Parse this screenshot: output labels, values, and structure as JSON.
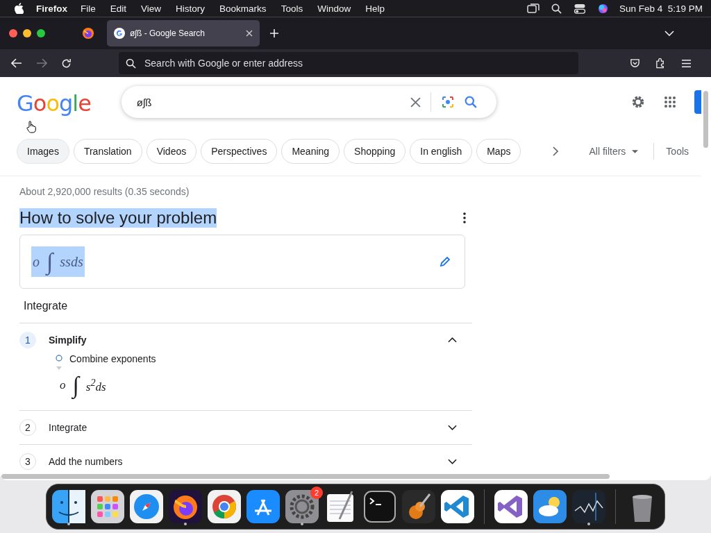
{
  "menubar": {
    "app": "Firefox",
    "menus": [
      "File",
      "Edit",
      "View",
      "History",
      "Bookmarks",
      "Tools",
      "Window",
      "Help"
    ],
    "clock": "Sun Feb 4  5:19 PM"
  },
  "tabs": [
    {
      "title": "øʃß - Google Search",
      "selected": true
    }
  ],
  "address_bar": {
    "placeholder": "Search with Google or enter address"
  },
  "nav": {
    "forward_disabled": true
  },
  "google": {
    "logo": "Google",
    "query": "øʃß",
    "chips": [
      {
        "label": "Images",
        "selected": true
      },
      {
        "label": "Translation",
        "selected": false
      },
      {
        "label": "Videos",
        "selected": false
      },
      {
        "label": "Perspectives",
        "selected": false
      },
      {
        "label": "Meaning",
        "selected": false
      },
      {
        "label": "Shopping",
        "selected": false
      },
      {
        "label": "In english",
        "selected": false
      },
      {
        "label": "Maps",
        "selected": false
      }
    ],
    "all_filters": "All filters",
    "tools": "Tools",
    "stats": "About 2,920,000 results (0.35 seconds)",
    "solver": {
      "heading": "How to solve your problem",
      "highlighted": true,
      "formula": {
        "coefficient": "o",
        "operator": "∫",
        "integrand": "ssds",
        "highlighted": true
      },
      "action": "Integrate",
      "steps": [
        {
          "number": "1",
          "title": "Simplify",
          "expanded": true,
          "substeps": [
            {
              "label": "Combine exponents",
              "formula": {
                "coefficient": "o",
                "operator": "∫",
                "integrand": "s$^{2}$ds"
              }
            }
          ]
        },
        {
          "number": "2",
          "title": "Integrate",
          "expanded": false
        },
        {
          "number": "3",
          "title": "Add the numbers",
          "expanded": false
        }
      ]
    }
  },
  "dock": [
    {
      "kind": "finder",
      "running": true
    },
    {
      "kind": "launchpad",
      "running": false
    },
    {
      "kind": "safari",
      "running": false
    },
    {
      "kind": "firefox",
      "running": true
    },
    {
      "kind": "chrome",
      "running": false
    },
    {
      "kind": "appstore",
      "running": false
    },
    {
      "kind": "settings",
      "running": true,
      "badge": "2"
    },
    {
      "kind": "textedit",
      "running": false
    },
    {
      "kind": "terminal",
      "running": false
    },
    {
      "kind": "garageband",
      "running": false
    },
    {
      "kind": "vscode",
      "running": false
    },
    {
      "kind": "divider"
    },
    {
      "kind": "visualstudio",
      "running": false
    },
    {
      "kind": "weather",
      "running": false
    },
    {
      "kind": "stocks",
      "running": true
    },
    {
      "kind": "divider"
    },
    {
      "kind": "trash",
      "running": false
    }
  ]
}
